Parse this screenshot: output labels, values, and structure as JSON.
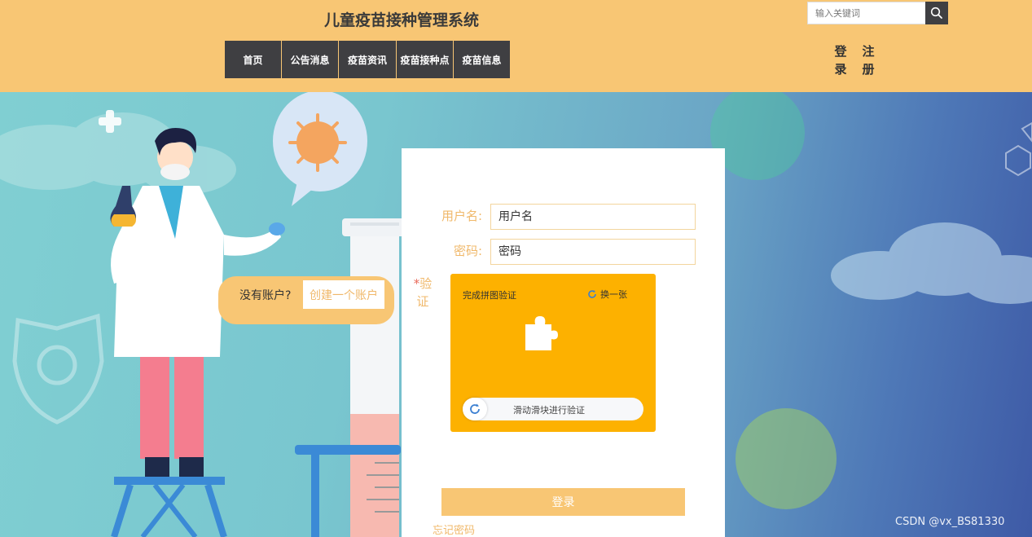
{
  "header": {
    "title": "儿童疫苗接种管理系统",
    "nav": [
      {
        "label": "首页"
      },
      {
        "label": "公告消息"
      },
      {
        "label": "疫苗资讯"
      },
      {
        "label": "疫苗接种点"
      },
      {
        "label": "疫苗信息"
      }
    ],
    "search": {
      "placeholder": "输入关键词"
    },
    "login_label": "登录",
    "register_label": "注册"
  },
  "form": {
    "username_label": "用户名:",
    "username_placeholder": "用户名",
    "password_label": "密码:",
    "password_placeholder": "密码",
    "captcha_star": "*",
    "captcha_label": "验证",
    "captcha_title": "完成拼图验证",
    "captcha_refresh": "换一张",
    "slider_text": "滑动滑块进行验证",
    "login_button": "登录",
    "forgot_password": "忘记密码"
  },
  "register": {
    "question": "没有账户?",
    "create_link": "创建一个账户"
  },
  "watermark": "CSDN @vx_BS81330",
  "colors": {
    "header_bg": "#f8c674",
    "nav_bg": "#3f3f42",
    "captcha_bg": "#fdb100",
    "label": "#f0b86a"
  }
}
